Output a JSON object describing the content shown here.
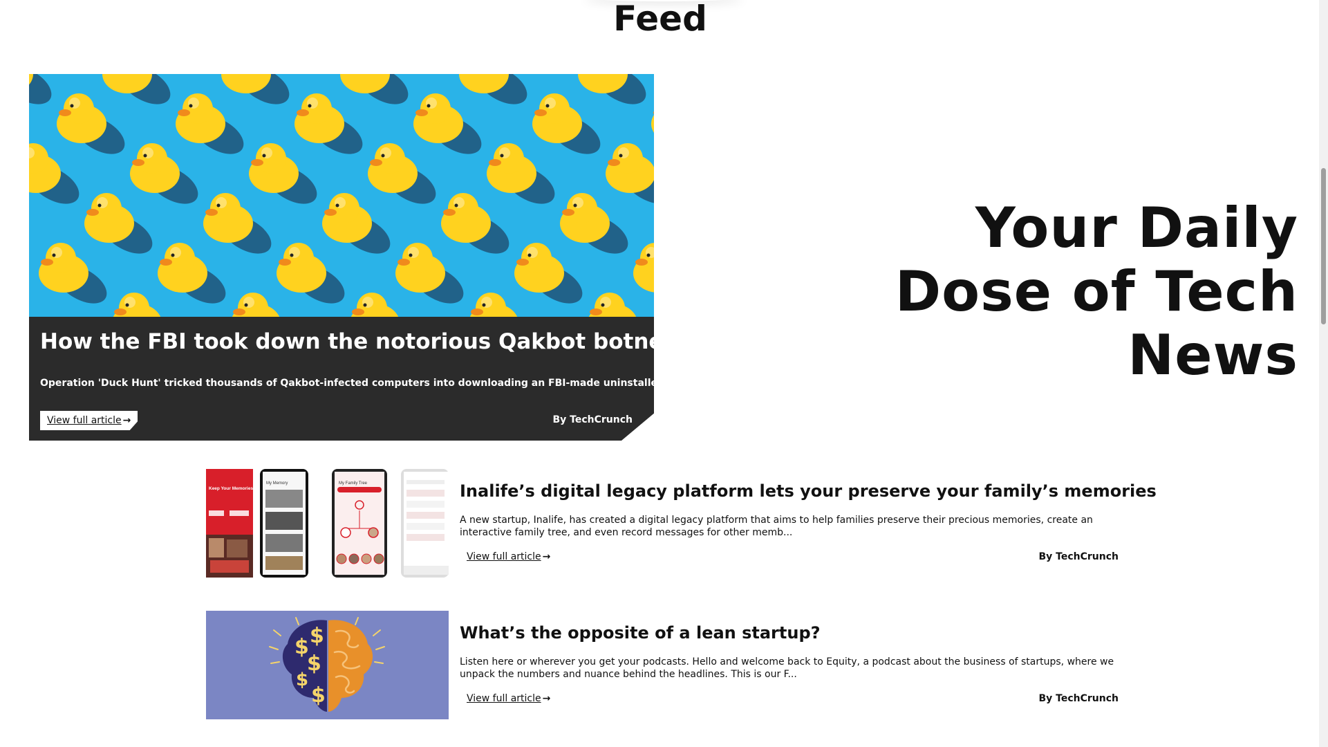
{
  "page": {
    "feed_title": "Feed",
    "tagline": "Your Daily Dose of Tech News"
  },
  "colors": {
    "hero_panel": "#2b2b2b",
    "hero_sky": "#2ab3e8",
    "duck_yellow": "#ffd21f",
    "duck_red": "#e8231a",
    "brain_bg": "#7b86c4"
  },
  "hero": {
    "image_icon": "rubber-ducks-image",
    "headline": "How the FBI took down the notorious Qakbot botnet",
    "description": "Operation 'Duck Hunt' tricked thousands of Qakbot-infected computers into downloading an FBI-made uninstaller",
    "link_label": "View full article",
    "byline": "By TechCrunch"
  },
  "articles": [
    {
      "image_icon": "inalife-phones-image",
      "title": "Inalife’s digital legacy platform lets your preserve your family’s memories",
      "description": "A new startup, Inalife, has created a digital legacy platform that aims to help families preserve their precious memories, create an interactive family tree, and even record messages for other memb...",
      "link_label": "View full article",
      "byline": "By TechCrunch",
      "thumb_text": {
        "promo": "Keep Your Memories Alive For Future Generations",
        "screen2": "My Memory",
        "screen3": "My Family Tree"
      }
    },
    {
      "image_icon": "money-brain-image",
      "title": "What’s the opposite of a lean startup?",
      "description": "Listen here or wherever you get your podcasts. Hello and welcome back to Equity, a podcast about the business of startups, where we unpack the numbers and nuance behind the headlines. This is our F...",
      "link_label": "View full article",
      "byline": "By TechCrunch"
    }
  ]
}
